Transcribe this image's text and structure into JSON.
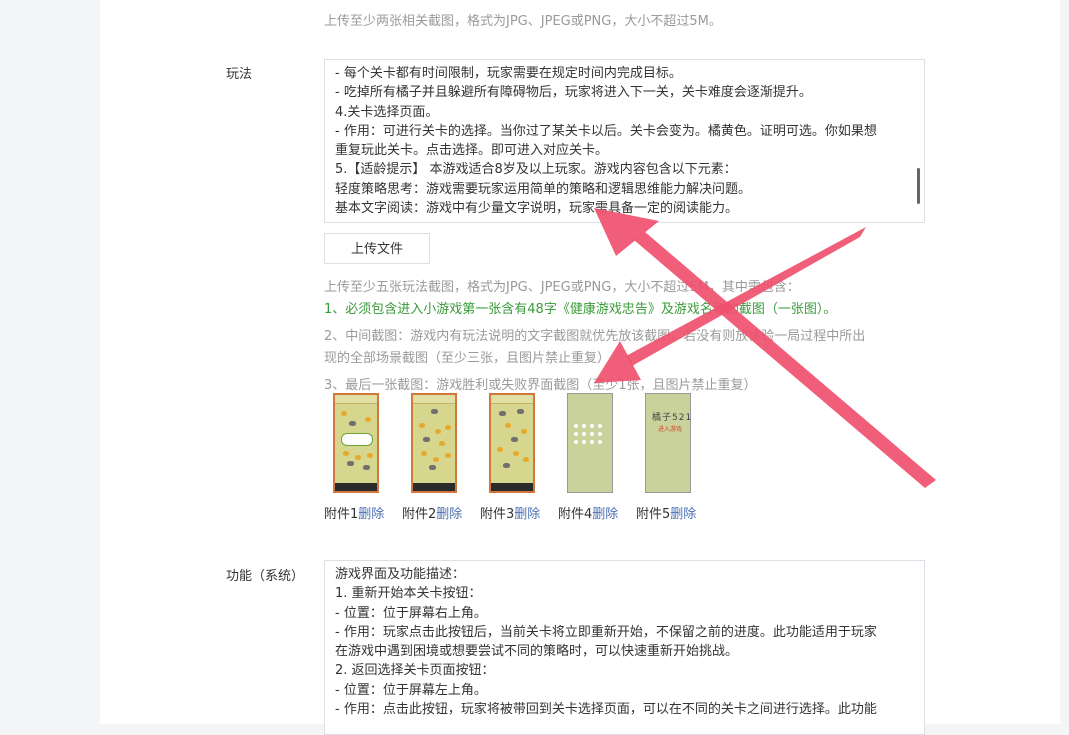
{
  "top_hint": "上传至少两张相关截图，格式为JPG、JPEG或PNG，大小不超过5M。",
  "gameplay": {
    "label": "玩法",
    "lines": [
      "- 每个关卡都有时间限制，玩家需要在规定时间内完成目标。",
      "- 吃掉所有橘子并且躲避所有障碍物后，玩家将进入下一关，关卡难度会逐渐提升。",
      "4.关卡选择页面。",
      "- 作用：可进行关卡的选择。当你过了某关卡以后。关卡会变为。橘黄色。证明可选。你如果想",
      "重复玩此关卡。点击选择。即可进入对应关卡。",
      "5.【适龄提示】 本游戏适合8岁及以上玩家。游戏内容包含以下元素：",
      "轻度策略思考：游戏需要玩家运用简单的策略和逻辑思维能力解决问题。",
      "基本文字阅读：游戏中有少量文字说明，玩家需具备一定的阅读能力。"
    ],
    "upload_button": "上传文件",
    "hint_1": "上传至少五张玩法截图，格式为JPG、JPEG或PNG，大小不超过5M，其中需包含：",
    "hint_2": "1、必须包含进入小游戏第一张含有48字《健康游戏忠告》及游戏名称的截图（一张图）。",
    "hint_3a": "2、中间截图：游戏内有玩法说明的文字截图就优先放该截图，若没有则放体验一局过程中所出",
    "hint_3b": "现的全部场景截图（至少三张，且图片禁止重复）",
    "hint_4": "3、最后一张截图：游戏胜利或失败界面截图（至少1张，且图片禁止重复）",
    "thumb_texts": {
      "t5_title": "橘子521",
      "t5_sub": "进入游戏"
    },
    "attachments": [
      {
        "name": "附件1",
        "action": "删除"
      },
      {
        "name": "附件2",
        "action": "删除"
      },
      {
        "name": "附件3",
        "action": "删除"
      },
      {
        "name": "附件4",
        "action": "删除"
      },
      {
        "name": "附件5",
        "action": "删除"
      }
    ]
  },
  "function": {
    "label": "功能（系统）",
    "lines": [
      "游戏界面及功能描述：",
      "1. 重新开始本关卡按钮：",
      "- 位置：位于屏幕右上角。",
      "- 作用：玩家点击此按钮后，当前关卡将立即重新开始，不保留之前的进度。此功能适用于玩家",
      "在游戏中遇到困境或想要尝试不同的策略时，可以快速重新开始挑战。",
      "2. 返回选择关卡页面按钮：",
      "- 位置：位于屏幕左上角。",
      "- 作用：点击此按钮，玩家将被带回到关卡选择页面，可以在不同的关卡之间进行选择。此功能"
    ]
  },
  "colors": {
    "annotation": "#f0506e",
    "link": "#4a6fb3",
    "green_hint": "#3a9b3a"
  }
}
